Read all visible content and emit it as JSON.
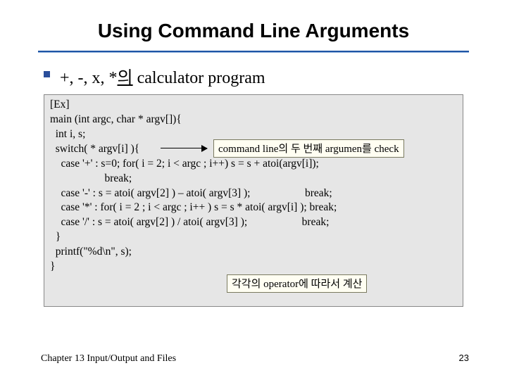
{
  "title": "Using Command Line Arguments",
  "bullet": {
    "prefix": "+, -, x, *",
    "mid": "의",
    "suffix": " calculator program"
  },
  "code": {
    "l1": "[Ex]",
    "l2": "main (int argc, char * argv[]){",
    "l3": "  int i, s;",
    "l4": "  switch( * argv[i] ){",
    "l5": "    case '+' : s=0; for( i = 2; i < argc ; i++) s = s + atoi(argv[i]);",
    "l6": "                    break;",
    "l7": "    case '-' : s = atoi( argv[2] ) – atoi( argv[3] );                    break;",
    "l8": "    case '*' : for( i = 2 ; i < argc ; i++ ) s = s * atoi( argv[i] ); break;",
    "l9": "    case '/' : s = atoi( argv[2] ) / atoi( argv[3] );                    break;",
    "l10": "  }",
    "l11": "  printf(\"%d\\n\", s);",
    "l12": "}"
  },
  "callout1": "command line의 두 번째 argumen를 check",
  "callout2": "각각의 operator에 따라서 계산",
  "footer_left": "Chapter 13  Input/Output and Files",
  "page_number": "23"
}
